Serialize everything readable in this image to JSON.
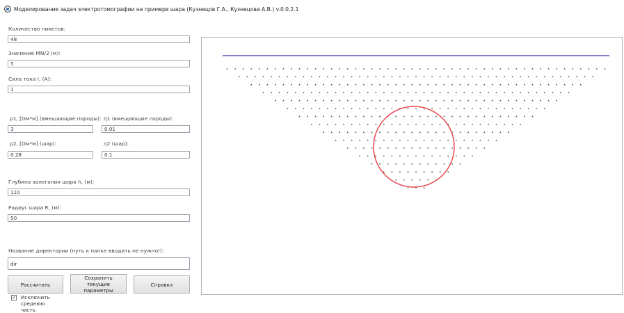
{
  "window": {
    "title": "Моделирование задач электротомографии на примере шара (Кузнецов Г.А., Кузнецова А.В.) v.0.0.2.1",
    "icon": "app-globe-icon"
  },
  "form": {
    "pickets": {
      "label": "Количество пикетов:",
      "value": "48"
    },
    "mn2": {
      "label": "Значение MN/2 (м):",
      "value": "5"
    },
    "current": {
      "label": "Сила тока I, (А):",
      "value": "1"
    },
    "rho1": {
      "label": "ρ1, [Ом*м] (вмещающие породы):",
      "value": "3"
    },
    "eta1": {
      "label": "η1 (вмещающие породы):",
      "value": "0.01"
    },
    "rho2": {
      "label": "ρ2, [Ом*м] (шар):",
      "value": "0.28"
    },
    "eta2": {
      "label": "η2 (шар):",
      "value": "0.1"
    },
    "depth": {
      "label": "Глубина залегания шара h, (м):",
      "value": "110"
    },
    "radius": {
      "label": "Радиус шара R, (м):",
      "value": "50"
    },
    "directory": {
      "label": "Название директории (путь к папке вводить не нужно!):",
      "value": "dir"
    }
  },
  "buttons": {
    "calculate": "Рассчитать",
    "save_params": "Сохранить текущие параметры",
    "help": "Справка"
  },
  "checkbox": {
    "label": "Исключить среднюю часть",
    "checked": true,
    "mark": "✓"
  },
  "plot": {
    "rows": [
      {
        "count": 48
      },
      {
        "count": 45
      },
      {
        "count": 42
      },
      {
        "count": 39
      },
      {
        "count": 36
      },
      {
        "count": 33
      },
      {
        "count": 30
      },
      {
        "count": 27
      },
      {
        "count": 24
      },
      {
        "count": 21
      },
      {
        "count": 18
      },
      {
        "count": 15
      },
      {
        "count": 12
      },
      {
        "count": 9
      },
      {
        "count": 6
      },
      {
        "count": 3
      }
    ],
    "colors": {
      "surface": "#5050b8",
      "points": "#505050",
      "sphere": "#e8474f"
    }
  }
}
